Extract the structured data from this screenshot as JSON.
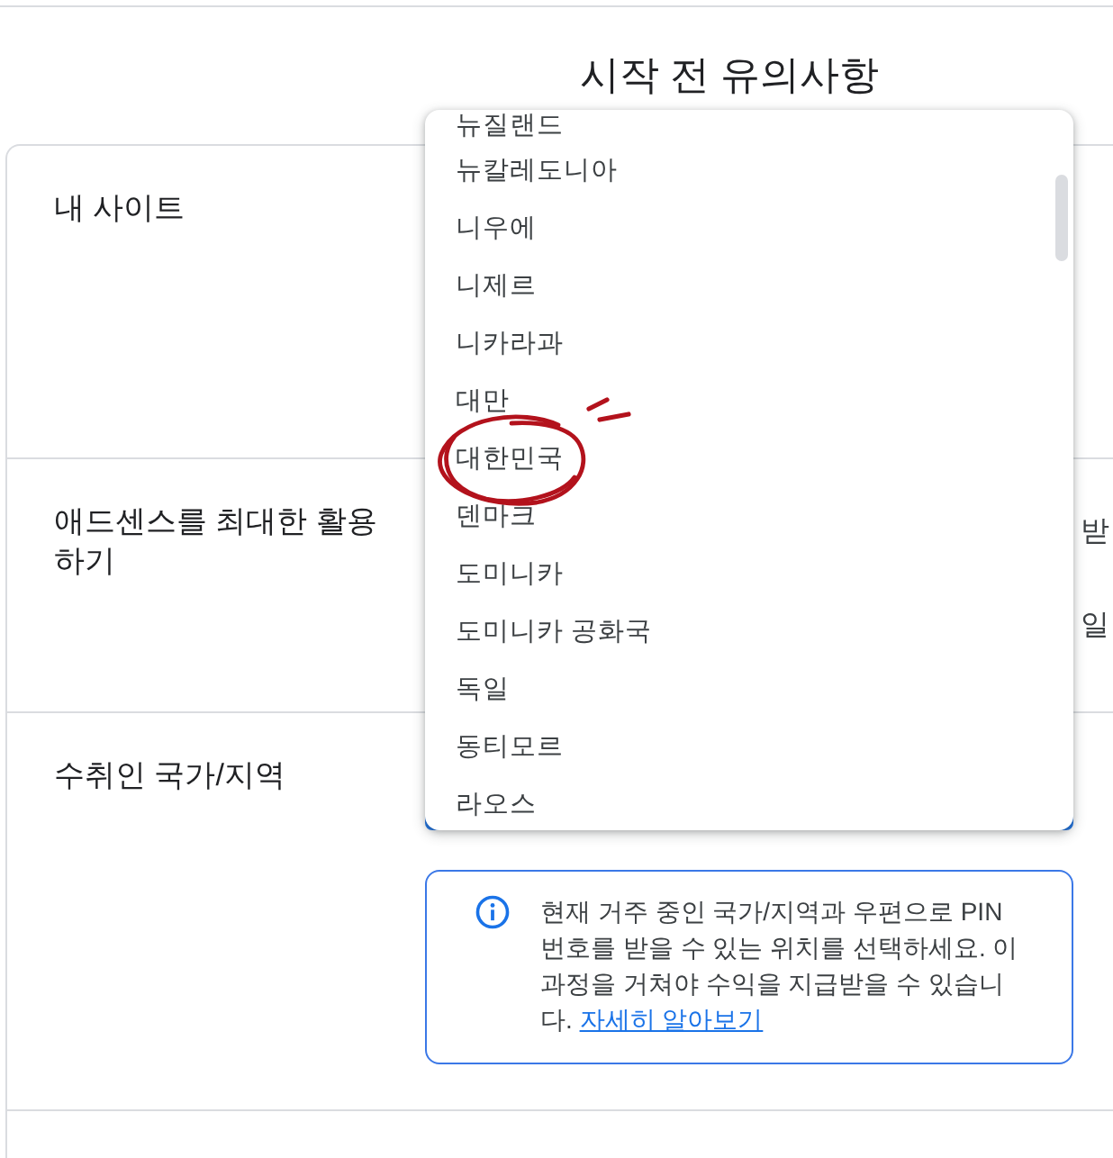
{
  "page_title": "시작 전 유의사항",
  "sections": [
    {
      "label": "내 사이트"
    },
    {
      "label": "애드센스를 최대한 활용하기",
      "content_lines": [
        "받",
        "일"
      ]
    },
    {
      "label": "수취인 국가/지역",
      "country_select": {
        "options": [
          {
            "label": "뉴질랜드",
            "selected": false,
            "circled": false
          },
          {
            "label": "뉴칼레도니아",
            "selected": false,
            "circled": false
          },
          {
            "label": "니우에",
            "selected": false,
            "circled": false
          },
          {
            "label": "니제르",
            "selected": false,
            "circled": false
          },
          {
            "label": "니카라과",
            "selected": false,
            "circled": false
          },
          {
            "label": "대만",
            "selected": false,
            "circled": false
          },
          {
            "label": "대한민국",
            "selected": false,
            "circled": true
          },
          {
            "label": "덴마크",
            "selected": false,
            "circled": false
          },
          {
            "label": "도미니카",
            "selected": false,
            "circled": false
          },
          {
            "label": "도미니카 공화국",
            "selected": false,
            "circled": false
          },
          {
            "label": "독일",
            "selected": false,
            "circled": false
          },
          {
            "label": "동티모르",
            "selected": false,
            "circled": false
          },
          {
            "label": "라오스",
            "selected": false,
            "circled": false
          }
        ]
      },
      "info": {
        "text": "현재 거주 중인 국가/지역과 우편으로 PIN 번호를 받을 수 있는 위치를 선택하세요. 이 과정을 거쳐야 수익을 지급받을 수 있습니다.",
        "link": "자세히 알아보기"
      }
    }
  ]
}
